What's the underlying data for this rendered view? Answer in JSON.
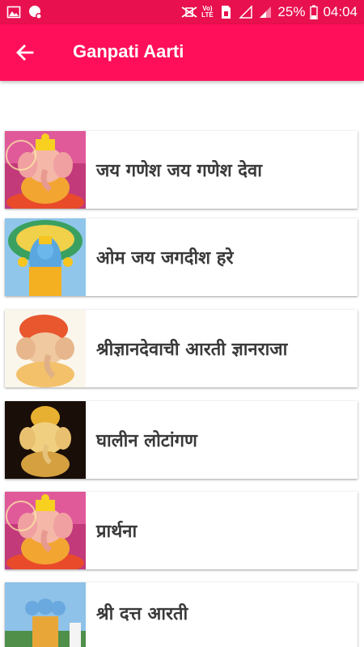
{
  "status_bar": {
    "volte": "Vo)",
    "lte": "LTE",
    "battery": "25%",
    "time": "04:04"
  },
  "app_bar": {
    "title": "Ganpati Aarti"
  },
  "aartis": [
    {
      "label": "जय गणेश जय गणेश देवा",
      "image": "ganesha-image"
    },
    {
      "label": "ओम जय जगदीश हरे",
      "image": "vishnu-image"
    },
    {
      "label": "श्रीज्ञानदेवाची आरती ज्ञानराजा",
      "image": "ganesha-image"
    },
    {
      "label": "घालीन लोटांगण",
      "image": "ganesha-image"
    },
    {
      "label": "प्रार्थना",
      "image": "ganesha-image"
    },
    {
      "label": "श्री दत्त आरती",
      "image": "dattatreya-image"
    }
  ],
  "colors": {
    "status_bar": "#e8104f",
    "app_bar": "#ff0f5a",
    "label_text": "#3a3a3a"
  }
}
